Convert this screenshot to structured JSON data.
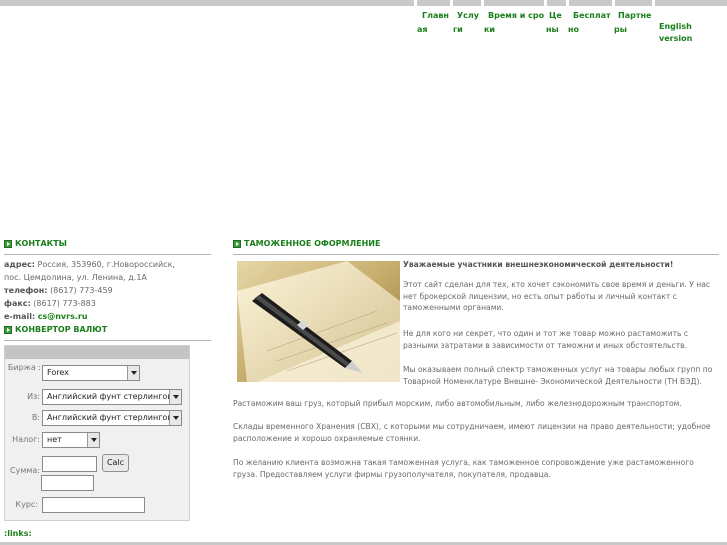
{
  "menu": {
    "items": [
      {
        "label": "Главная"
      },
      {
        "label": "Услуги"
      },
      {
        "label": "Время и сроки"
      },
      {
        "label": "Цены"
      },
      {
        "label": "Бесплатно"
      },
      {
        "label": "Партнеры"
      }
    ],
    "language_link": "English version"
  },
  "contacts": {
    "heading": "КОНТАКТЫ",
    "address_label": "адрес:",
    "address_line1": "Россия, 353960, г.Новороссийск,",
    "address_line2": "пос. Цемдолина, ул. Ленина, д.1А",
    "phone_label": "телефон:",
    "phone_value": "(8617) 773-459",
    "fax_label": "факс:",
    "fax_value": "(8617) 773-883",
    "email_label": "e-mail:",
    "email_value": "cs@nvrs.ru"
  },
  "converter": {
    "heading": "КОНВЕРТОР ВАЛЮТ",
    "exchange_label": "Биржа :",
    "exchange_value": "Forex",
    "from_label": "Из:",
    "from_value": "Английский фунт стерлингов",
    "to_label": "В:",
    "to_value": "Английский фунт стерлингов",
    "tax_label": "Налог:",
    "tax_value": "нет",
    "amount_label": "Сумма:",
    "calc_button": "Calc",
    "rate_label": "Курс:"
  },
  "links_label": ":links:",
  "article": {
    "heading": "ТАМОЖЕННОЕ ОФОРМЛЕНИЕ",
    "lead": "Уважаемые участники внешнеэкономической деятельности!",
    "p1": "Этот сайт сделан для тех, кто хочет сэкономить свое время и деньги. У нас нет брокерской лицензии, но есть опыт работы и личный контакт с таможенными органами.",
    "p2": "Не для кого ни секрет, что один и тот же товар можно растаможить с разными затратами в зависимости от таможни и иных обстоятельств.",
    "p3": "Мы оказываем полный спектр таможенных услуг на товары любых групп по Товарной Номенклатуре Внешне- Экономической Деятельности (ТН ВЭД).",
    "p4": "Растаможим ваш груз, который прибыл морским, либо автомобильным, либо железнодорожным транспортом.",
    "p5": "Склады временного Хранения (СВХ), с которыми мы сотрудничаем, имеют лицензии на право деятельности; удобное расположение и хорошо охраняемые стоянки.",
    "p6": "По желанию клиента возможна такая таможенная услуга, как таможенное сопровождение уже растаможенного груза. Предоставляем услуги фирмы грузополучателя, покупателя, продавца."
  }
}
